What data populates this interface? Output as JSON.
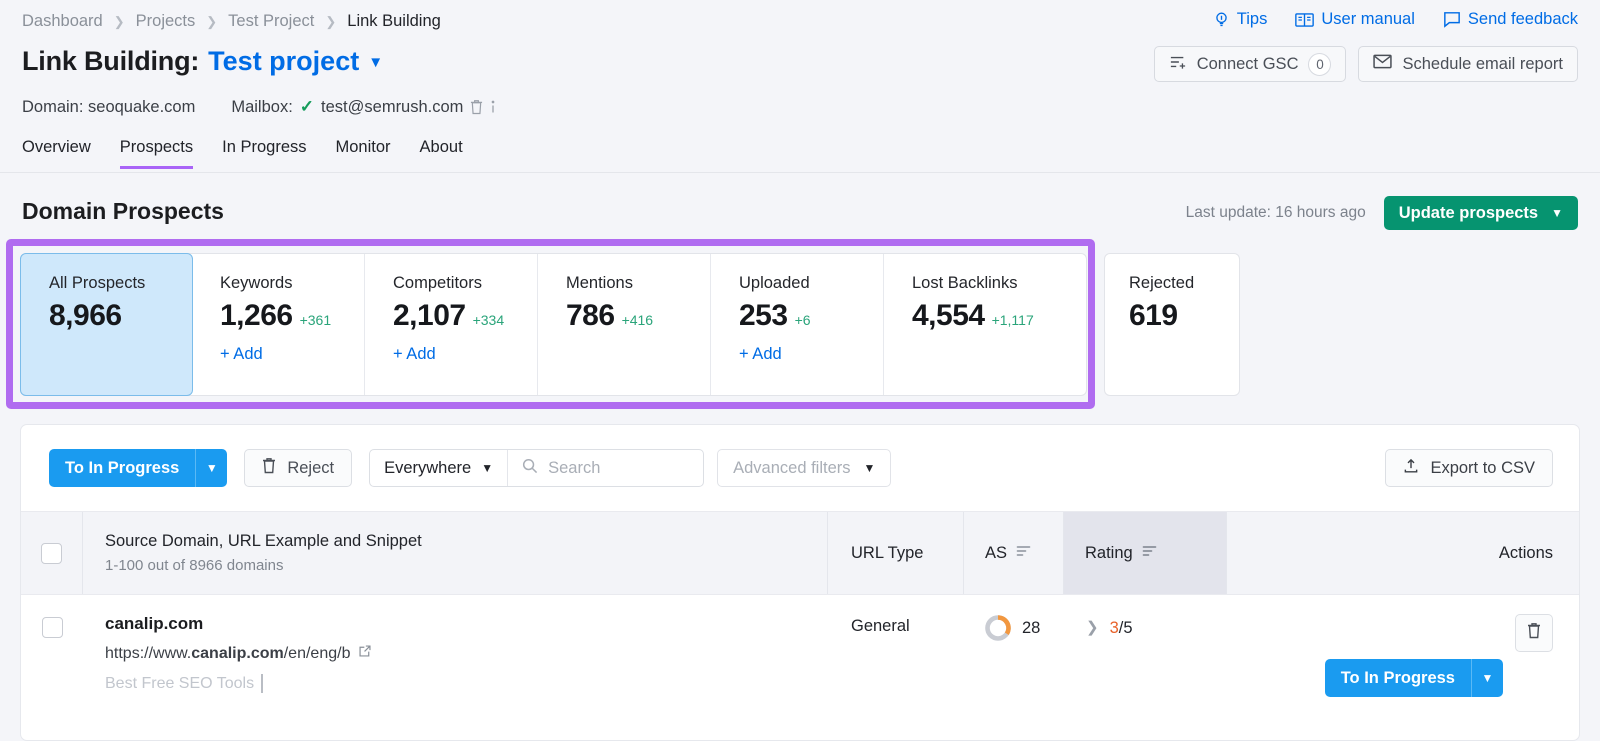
{
  "breadcrumb": [
    {
      "label": "Dashboard",
      "current": false
    },
    {
      "label": "Projects",
      "current": false
    },
    {
      "label": "Test Project",
      "current": false
    },
    {
      "label": "Link Building",
      "current": true
    }
  ],
  "header": {
    "links": [
      {
        "label": "Tips",
        "icon": "lightbulb-icon"
      },
      {
        "label": "User manual",
        "icon": "book-icon"
      },
      {
        "label": "Send feedback",
        "icon": "chat-icon"
      }
    ],
    "title_prefix": "Link Building:",
    "title_project": "Test project",
    "connect_gsc_label": "Connect GSC",
    "connect_gsc_count": "0",
    "schedule_report_label": "Schedule email report"
  },
  "meta": {
    "domain_label": "Domain: seoquake.com",
    "mailbox_label": "Mailbox:",
    "mailbox_value": "test@semrush.com"
  },
  "tabs": [
    {
      "label": "Overview",
      "active": false
    },
    {
      "label": "Prospects",
      "active": true
    },
    {
      "label": "In Progress",
      "active": false
    },
    {
      "label": "Monitor",
      "active": false
    },
    {
      "label": "About",
      "active": false
    }
  ],
  "section": {
    "title": "Domain Prospects",
    "last_update": "Last update: 16 hours ago",
    "update_button": "Update prospects"
  },
  "cards": [
    {
      "label": "All Prospects",
      "value": "8,966",
      "delta": "",
      "add": "",
      "active": true
    },
    {
      "label": "Keywords",
      "value": "1,266",
      "delta": "+361",
      "add": "+ Add",
      "active": false
    },
    {
      "label": "Competitors",
      "value": "2,107",
      "delta": "+334",
      "add": "+ Add",
      "active": false
    },
    {
      "label": "Mentions",
      "value": "786",
      "delta": "+416",
      "add": "",
      "active": false
    },
    {
      "label": "Uploaded",
      "value": "253",
      "delta": "+6",
      "add": "+ Add",
      "active": false
    },
    {
      "label": "Lost Backlinks",
      "value": "4,554",
      "delta": "+1,117",
      "add": "",
      "active": false
    }
  ],
  "rejected_card": {
    "label": "Rejected",
    "value": "619"
  },
  "toolbar": {
    "to_in_progress_label": "To In Progress",
    "reject_label": "Reject",
    "scope_label": "Everywhere",
    "search_placeholder": "Search",
    "search_value": "",
    "advanced_filters_label": "Advanced filters",
    "export_label": "Export to CSV"
  },
  "table": {
    "headers": {
      "domain": "Source Domain, URL Example and Snippet",
      "domain_sub": "1-100 out of 8966 domains",
      "url_type": "URL Type",
      "as": "AS",
      "rating": "Rating",
      "actions": "Actions"
    },
    "rows": [
      {
        "domain": "canalip.com",
        "url_prefix": "https://www.",
        "url_bold": "canalip.com",
        "url_suffix": "/en/eng/b",
        "snippet": "Best Free SEO Tools",
        "url_type": "General",
        "as_value": "28",
        "as_percent": 28,
        "rating_current": "3",
        "rating_total": "/5",
        "action_label": "To In Progress"
      }
    ]
  },
  "colors": {
    "accent_blue": "#006ce5",
    "primary_blue": "#1a9bf0",
    "green": "#069470",
    "delta_green": "#2aa47a",
    "highlight_purple": "#b06cf0",
    "tab_purple": "#a964f7",
    "orange": "#e8622a",
    "page_bg": "#f4f5f9"
  }
}
